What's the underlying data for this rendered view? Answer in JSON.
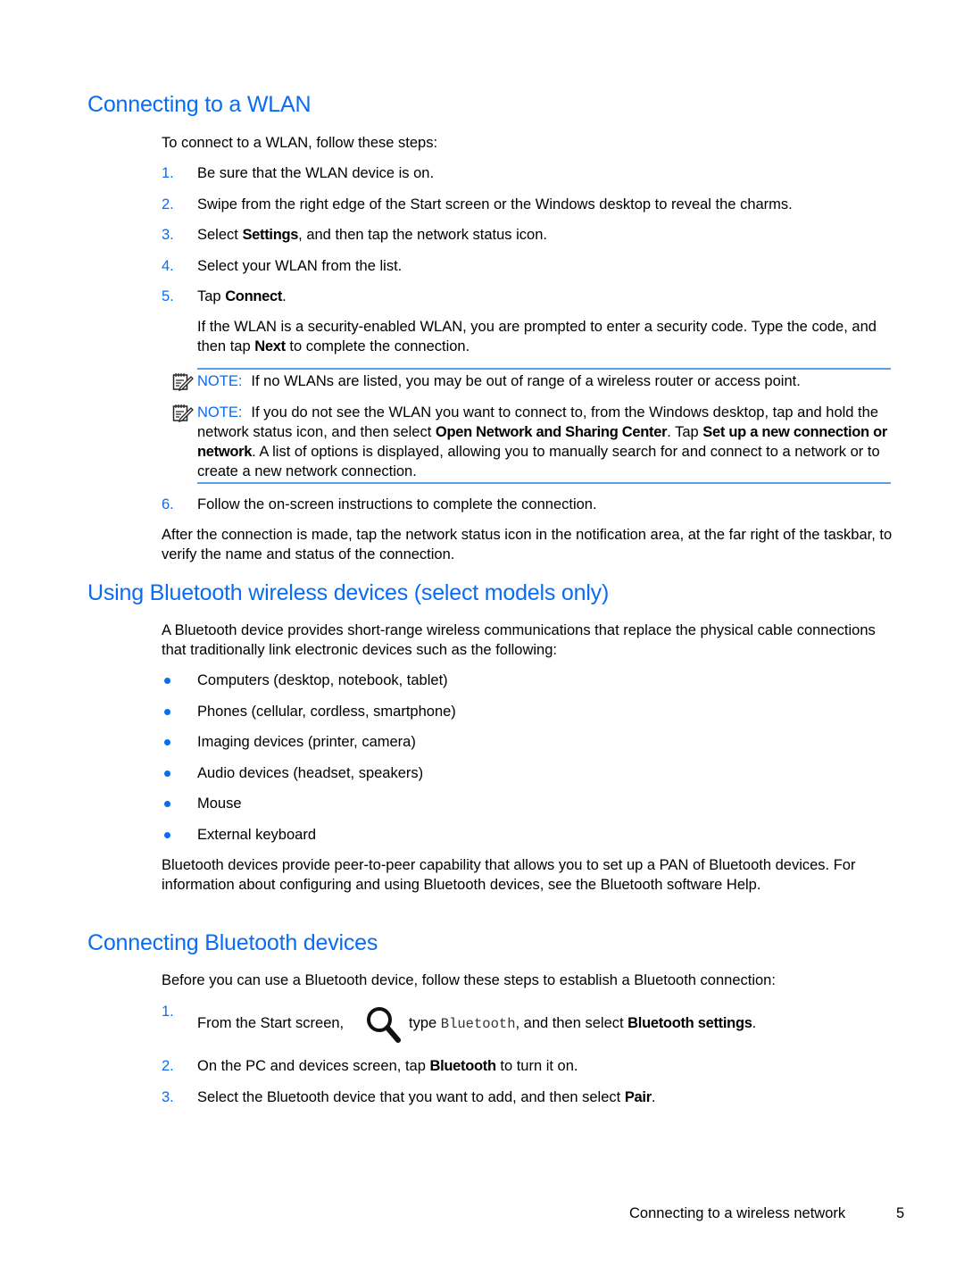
{
  "colors": {
    "heading": "#0a6cf0",
    "accent": "#0a6cf0",
    "note_rule": "#5b9ee8",
    "text": "#000000"
  },
  "sections": {
    "wlan": {
      "title": "Connecting to a WLAN",
      "intro": "To connect to a WLAN, follow these steps:",
      "steps": [
        {
          "num": "1.",
          "text": "Be sure that the WLAN device is on."
        },
        {
          "num": "2.",
          "text": "Swipe from the right edge of the Start screen or the Windows desktop to reveal the charms."
        },
        {
          "num": "3.",
          "pre": "Select ",
          "bold": "Settings",
          "post": ", and then tap the network status icon."
        },
        {
          "num": "4.",
          "text": "Select your WLAN from the list."
        },
        {
          "num": "5.",
          "pre": "Tap ",
          "bold": "Connect",
          "post": "."
        }
      ],
      "step5_detail": {
        "pre": "If the WLAN is a security-enabled WLAN, you are prompted to enter a security code. Type the code, and then tap ",
        "bold": "Next",
        "post": " to complete the connection."
      },
      "notes": [
        {
          "icon": "note-icon",
          "label": "NOTE:",
          "text": "If no WLANs are listed, you may be out of range of a wireless router or access point."
        },
        {
          "icon": "note-icon",
          "label": "NOTE:",
          "pre": "If you do not see the WLAN you want to connect to, from the Windows desktop, tap and hold the network status icon, and then select ",
          "bold1": "Open Network and Sharing Center",
          "mid": ". Tap ",
          "bold2": "Set up a new connection or network",
          "post": ". A list of options is displayed, allowing you to manually search for and connect to a network or to create a new network connection."
        }
      ],
      "step6": {
        "num": "6.",
        "text": "Follow the on-screen instructions to complete the connection."
      },
      "after": "After the connection is made, tap the network status icon in the notification area, at the far right of the taskbar, to verify the name and status of the connection."
    },
    "bluetooth": {
      "title": "Using Bluetooth wireless devices (select models only)",
      "intro": "A Bluetooth device provides short-range wireless communications that replace the physical cable connections that traditionally link electronic devices such as the following:",
      "bullets": [
        "Computers (desktop, notebook, tablet)",
        "Phones (cellular, cordless, smartphone)",
        "Imaging devices (printer, camera)",
        "Audio devices (headset, speakers)",
        "Mouse",
        "External keyboard"
      ],
      "outro": "Bluetooth devices provide peer-to-peer capability that allows you to set up a PAN of Bluetooth devices. For information about configuring and using Bluetooth devices, see the Bluetooth software Help."
    },
    "connecting_bt": {
      "title": "Connecting Bluetooth devices",
      "intro": "Before you can use a Bluetooth device, follow these steps to establish a Bluetooth connection:",
      "step1": {
        "num": "1.",
        "pre": "From the Start screen,",
        "icon": "search-icon",
        "mid": "type ",
        "code": "Bluetooth",
        "mid2": ", and then select ",
        "bold": "Bluetooth settings",
        "post": "."
      },
      "step2": {
        "num": "2.",
        "pre": "On the PC and devices screen, tap ",
        "bold": "Bluetooth",
        "post": " to turn it on."
      },
      "step3": {
        "num": "3.",
        "pre": "Select the Bluetooth device that you want to add, and then select ",
        "bold": "Pair",
        "post": "."
      }
    }
  },
  "footer": {
    "section_title": "Connecting to a wireless network",
    "page_number": "5"
  }
}
